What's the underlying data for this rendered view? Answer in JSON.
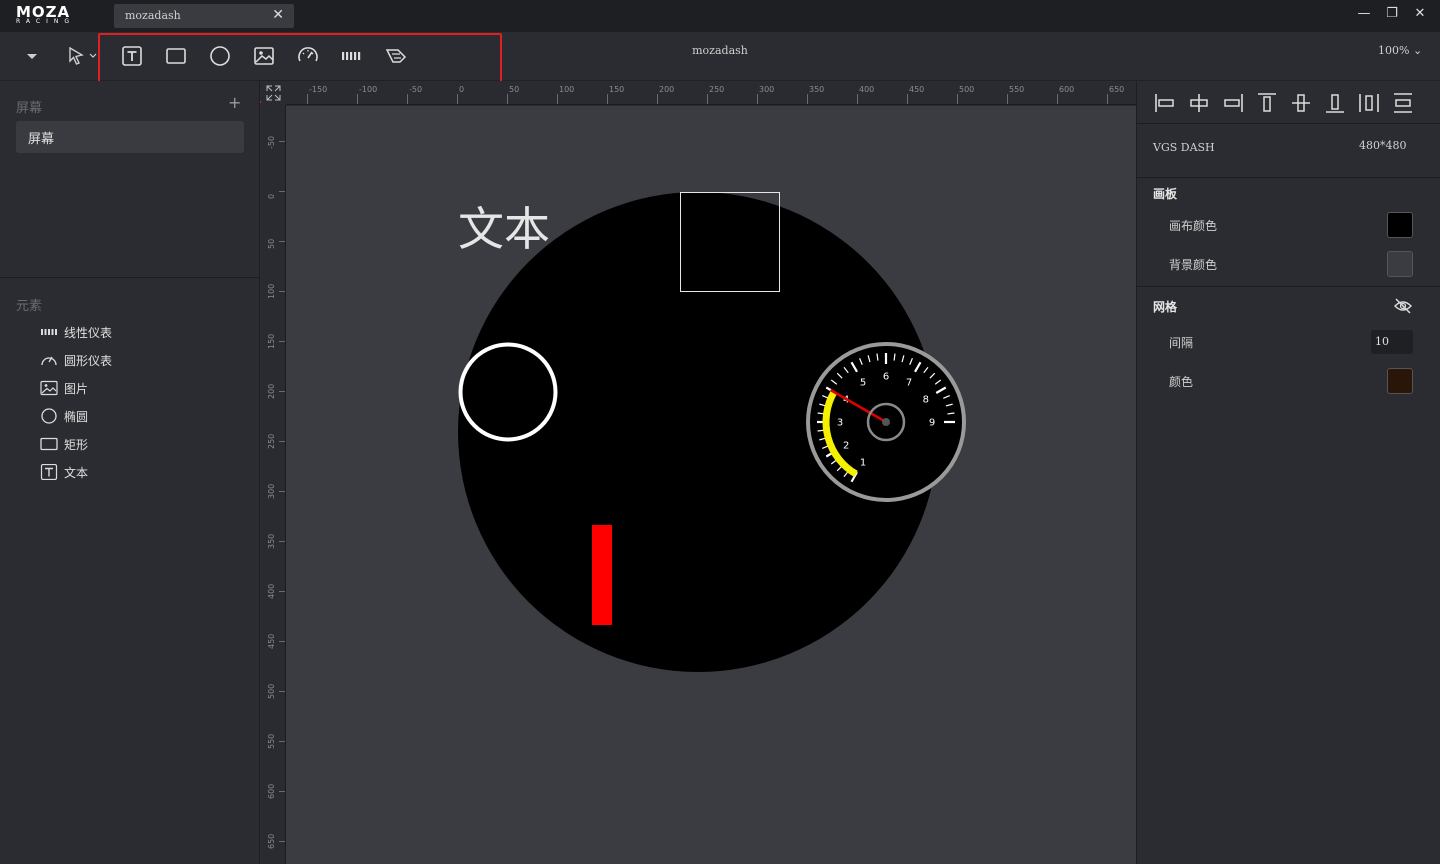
{
  "app": {
    "logo_main": "MOZA",
    "logo_sub": "RACING",
    "tab_title": "mozadash",
    "window_controls": [
      "minimize-icon",
      "restore-icon",
      "close-icon"
    ]
  },
  "toolbar": {
    "doc_title": "mozadash",
    "zoom": "100%",
    "tools": [
      "text-tool-icon",
      "rectangle-tool-icon",
      "ellipse-tool-icon",
      "image-tool-icon",
      "circular-gauge-tool-icon",
      "linear-gauge-tool-icon",
      "eraser-tool-icon"
    ]
  },
  "left_panel": {
    "screens_title": "屏幕",
    "add_label": "+",
    "screens": [
      {
        "label": "屏幕"
      }
    ],
    "elements_title": "元素",
    "elements": [
      {
        "label": "线性仪表",
        "icon": "linear-gauge-icon"
      },
      {
        "label": "圆形仪表",
        "icon": "circular-gauge-icon"
      },
      {
        "label": "图片",
        "icon": "image-icon"
      },
      {
        "label": "椭圆",
        "icon": "ellipse-icon"
      },
      {
        "label": "矩形",
        "icon": "rectangle-icon"
      },
      {
        "label": "文本",
        "icon": "text-icon"
      }
    ]
  },
  "rulers": {
    "top": [
      "-150",
      "-100",
      "-50",
      "0",
      "50",
      "100",
      "150",
      "200",
      "250",
      "300",
      "350",
      "400",
      "450",
      "500",
      "550",
      "600",
      "650"
    ],
    "left": [
      "-50",
      "0",
      "50",
      "100",
      "150",
      "200",
      "250",
      "300",
      "350",
      "400",
      "450",
      "500",
      "550",
      "600",
      "650"
    ]
  },
  "canvas": {
    "text_element": "文本",
    "gauge": {
      "labels": [
        "1",
        "2",
        "3",
        "4",
        "5",
        "6",
        "7",
        "8",
        "9"
      ],
      "needle_value": 4,
      "arc_color": "#f4f000",
      "redline_color": "#e00000"
    },
    "bar_color": "#ff0000"
  },
  "right_panel": {
    "device_name": "VGS DASH",
    "resolution": "480*480",
    "panel_title": "画板",
    "canvas_color_label": "画布颜色",
    "canvas_color": "#000000",
    "bg_color_label": "背景颜色",
    "bg_color": "#3b3c42",
    "grid_title": "网格",
    "interval_label": "间隔",
    "interval_value": "10",
    "grid_color_label": "颜色",
    "grid_color": "#2a1608"
  }
}
